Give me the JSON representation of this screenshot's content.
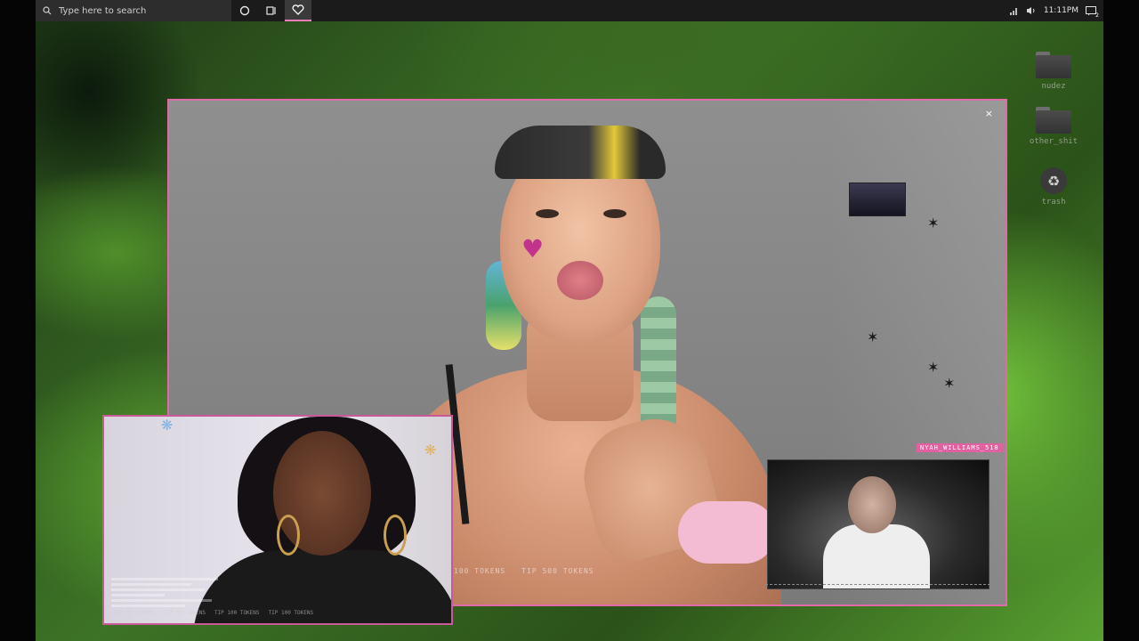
{
  "taskbar": {
    "search_placeholder": "Type here to search",
    "time": "11:11PM",
    "notification_count": "2"
  },
  "desktop_icons": [
    {
      "label": "nudez",
      "icon": "folder-icon"
    },
    {
      "label": "other_shit",
      "icon": "folder-icon"
    },
    {
      "label": "trash",
      "icon": "recycle-bin-icon"
    }
  ],
  "main_window": {
    "close_label": "×",
    "tip_overlay": [
      "100 TOKENS",
      "TIP 500 TOKENS"
    ]
  },
  "right_cam": {
    "username": "NYAH_WILLIAMS_510"
  },
  "left_cam": {
    "tip_overlay": [
      "TIP 50 TOKENS",
      "TIP 80 TOKENS",
      "TIP 100 TOKENS",
      "TIP 100 TOKENS"
    ]
  },
  "colors": {
    "accent": "#e06aa6",
    "taskbar": "#1b1b1b"
  }
}
